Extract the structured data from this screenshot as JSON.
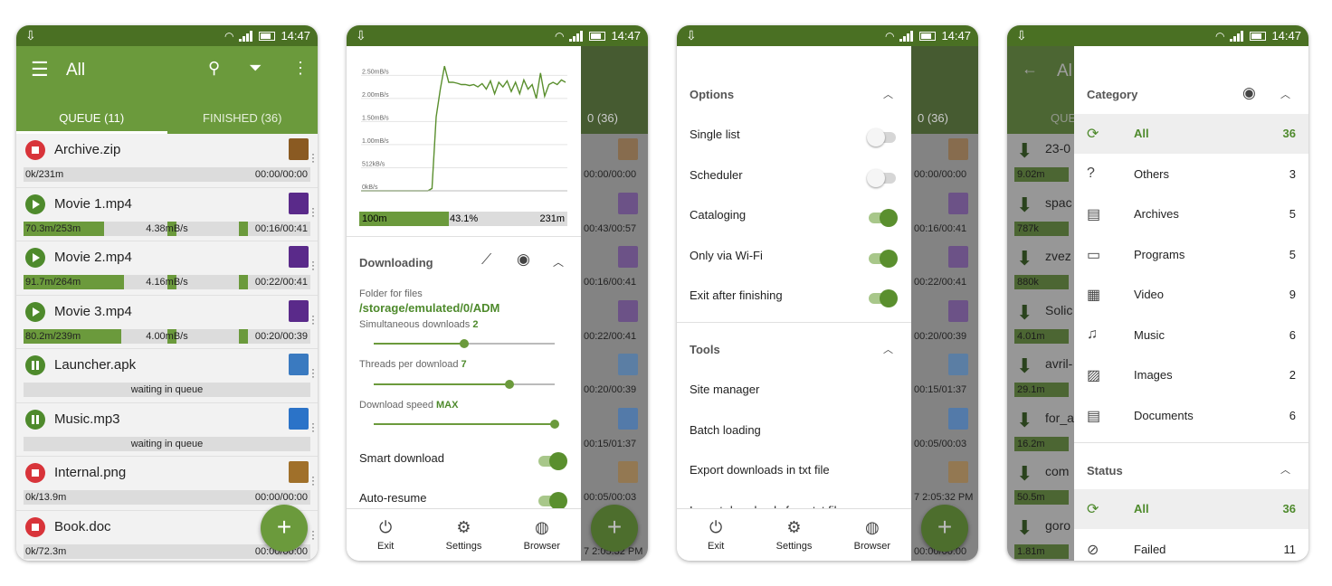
{
  "status": {
    "time": "14:47"
  },
  "phone1": {
    "title": "All",
    "tabs": [
      "QUEUE (11)",
      "FINISHED (36)"
    ],
    "items": [
      {
        "name": "Archive.zip",
        "state": "stop",
        "left": "0k/231m",
        "mid": "",
        "right": "00:00/00:00",
        "fill": 0
      },
      {
        "name": "Movie 1.mp4",
        "state": "play",
        "left": "70.3m/253m",
        "mid": "4.38mB/s",
        "right": "00:16/00:41",
        "fill": 28
      },
      {
        "name": "Movie 2.mp4",
        "state": "play",
        "left": "91.7m/264m",
        "mid": "4.16mB/s",
        "right": "00:22/00:41",
        "fill": 35
      },
      {
        "name": "Movie 3.mp4",
        "state": "play",
        "left": "80.2m/239m",
        "mid": "4.00mB/s",
        "right": "00:20/00:39",
        "fill": 34
      },
      {
        "name": "Launcher.apk",
        "state": "pause",
        "left": "",
        "mid": "waiting in queue",
        "right": "",
        "fill": 0
      },
      {
        "name": "Music.mp3",
        "state": "pause",
        "left": "",
        "mid": "waiting in queue",
        "right": "",
        "fill": 0
      },
      {
        "name": "Internal.png",
        "state": "stop",
        "left": "0k/13.9m",
        "mid": "",
        "right": "00:00/00:00",
        "fill": 0
      },
      {
        "name": "Book.doc",
        "state": "stop",
        "left": "0k/72.3m",
        "mid": "",
        "right": "00:00/00:00",
        "fill": 0
      }
    ],
    "fab": "+"
  },
  "phone2": {
    "chart_data": {
      "type": "line",
      "title": "",
      "xlabel": "",
      "ylabel": "",
      "y_ticks": [
        "0kB/s",
        "512kB/s",
        "1.00mB/s",
        "1.50mB/s",
        "2.00mB/s",
        "2.50mB/s"
      ],
      "ylim": [
        0,
        2.8
      ],
      "series": [
        {
          "values": [
            0,
            0,
            0,
            0,
            0,
            0,
            0,
            0,
            0,
            0,
            0,
            0,
            0,
            0,
            0,
            0,
            0,
            0.05,
            1.6,
            2.2,
            2.7,
            2.35,
            2.35,
            2.33,
            2.3,
            2.3,
            2.28,
            2.3,
            2.25,
            2.32,
            2.2,
            2.38,
            2.1,
            2.35,
            2.25,
            2.38,
            2.15,
            2.35,
            2.1,
            2.4,
            2.2,
            2.3,
            2.0,
            2.55,
            2.05,
            2.3,
            2.35,
            2.3,
            2.4,
            2.35
          ]
        }
      ]
    },
    "progress": {
      "left": "100m",
      "mid": "43.1%",
      "right": "231m"
    },
    "section": "Downloading",
    "folder_label": "Folder for files",
    "folder_path": "/storage/emulated/0/ADM",
    "simultaneous_label": "Simultaneous downloads",
    "simultaneous_value": "2",
    "simultaneous_fraction": 0.5,
    "threads_label": "Threads per download",
    "threads_value": "7",
    "threads_fraction": 0.75,
    "speed_label": "Download speed",
    "speed_value": "MAX",
    "speed_fraction": 1.0,
    "smart_download": "Smart download",
    "auto_resume": "Auto-resume",
    "nav": [
      "Exit",
      "Settings",
      "Browser"
    ]
  },
  "phone3": {
    "options_title": "Options",
    "options": [
      {
        "label": "Single list",
        "on": false
      },
      {
        "label": "Scheduler",
        "on": false
      },
      {
        "label": "Cataloging",
        "on": true
      },
      {
        "label": "Only via Wi-Fi",
        "on": true
      },
      {
        "label": "Exit after finishing",
        "on": true
      }
    ],
    "tools_title": "Tools",
    "tools": [
      "Site manager",
      "Batch loading",
      "Export downloads in txt file",
      "Import downloads from txt file"
    ],
    "nav": [
      "Exit",
      "Settings",
      "Browser"
    ]
  },
  "phone4": {
    "category_title": "Category",
    "categories": [
      {
        "name": "All",
        "count": "36",
        "icon": "sync-icon",
        "selected": true
      },
      {
        "name": "Others",
        "count": "3",
        "icon": "question-icon",
        "selected": false
      },
      {
        "name": "Archives",
        "count": "5",
        "icon": "archive-icon",
        "selected": false
      },
      {
        "name": "Programs",
        "count": "5",
        "icon": "monitor-icon",
        "selected": false
      },
      {
        "name": "Video",
        "count": "9",
        "icon": "film-icon",
        "selected": false
      },
      {
        "name": "Music",
        "count": "6",
        "icon": "music-icon",
        "selected": false
      },
      {
        "name": "Images",
        "count": "2",
        "icon": "image-icon",
        "selected": false
      },
      {
        "name": "Documents",
        "count": "6",
        "icon": "document-icon",
        "selected": false
      }
    ],
    "status_title": "Status",
    "statuses": [
      {
        "name": "All",
        "count": "36",
        "icon": "sync-icon",
        "selected": true
      },
      {
        "name": "Failed",
        "count": "11",
        "icon": "block-icon",
        "selected": false
      }
    ],
    "bg_title": "Al",
    "bg_tab": "QUE",
    "bg_items": [
      {
        "name": "23-0",
        "size": "9.02m"
      },
      {
        "name": "spac",
        "size": "787k"
      },
      {
        "name": "zvez",
        "size": "880k"
      },
      {
        "name": "Solic",
        "size": "4.01m"
      },
      {
        "name": "avril-",
        "size": "29.1m"
      },
      {
        "name": "for_a",
        "size": "16.2m"
      },
      {
        "name": "com",
        "size": "50.5m"
      },
      {
        "name": "goro",
        "size": "1.81m"
      }
    ]
  },
  "bg": {
    "tab_finished_partial": "0 (36)",
    "times": [
      "00:00/00:00",
      "00:43/00:57",
      "00:16/00:41",
      "00:22/00:41",
      "00:20/00:39",
      "00:15/01:37",
      "00:05/00:03",
      "7 2:05:32 PM"
    ],
    "times3": [
      "00:00/00:00",
      "00:16/00:41",
      "00:22/00:41",
      "00:20/00:39",
      "00:15/01:37",
      "00:05/00:03",
      "7 2:05:32 PM",
      "00:00/00:00"
    ]
  },
  "colors": {
    "accent": "#6b9a3c",
    "dark": "#4a7023",
    "red": "#d8343a"
  }
}
